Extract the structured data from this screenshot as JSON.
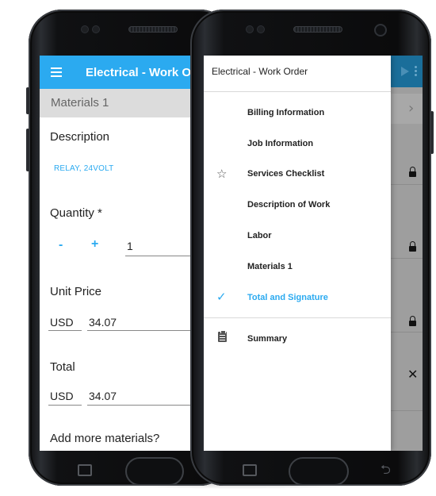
{
  "left_phone": {
    "app_bar": {
      "title": "Electrical - Work Or",
      "menu_icon": "hamburger-icon"
    },
    "section_title": "Materials 1",
    "description": {
      "label": "Description",
      "value": "RELAY, 24VOLT"
    },
    "quantity": {
      "label": "Quantity *",
      "minus": "-",
      "plus": "+",
      "value": "1"
    },
    "unit_price": {
      "label": "Unit Price",
      "currency": "USD",
      "value": "34.07"
    },
    "total": {
      "label": "Total",
      "currency": "USD",
      "value": "34.07"
    },
    "add_more": {
      "label": "Add more materials?"
    }
  },
  "right_phone": {
    "drawer": {
      "title": "Electrical - Work Order",
      "items": [
        {
          "label": "Billing Information",
          "icon": ""
        },
        {
          "label": "Job Information",
          "icon": ""
        },
        {
          "label": "Services Checklist",
          "icon": "star-outline-icon"
        },
        {
          "label": "Description of Work",
          "icon": ""
        },
        {
          "label": "Labor",
          "icon": ""
        },
        {
          "label": "Materials 1",
          "icon": ""
        },
        {
          "label": "Total and Signature",
          "icon": "check-icon",
          "active": true
        },
        {
          "label": "Summary",
          "icon": "clipboard-icon"
        }
      ]
    },
    "background_icons": [
      "share-icon",
      "overflow-menu-icon",
      "chevron-right-icon",
      "lock-icon",
      "close-icon"
    ]
  },
  "colors": {
    "accent": "#2baaf0",
    "section_bar": "#dcdcdc",
    "scrim": "#9e9e9e"
  }
}
